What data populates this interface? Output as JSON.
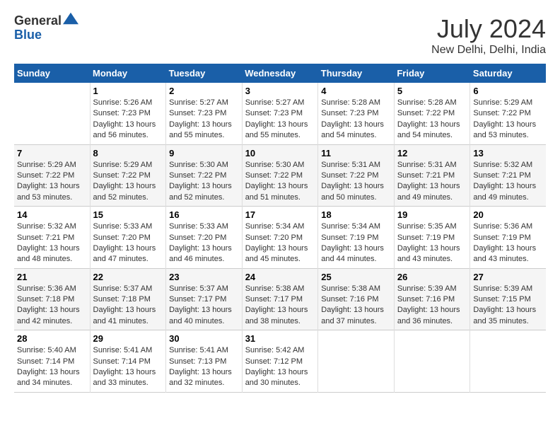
{
  "logo": {
    "general": "General",
    "blue": "Blue"
  },
  "title": "July 2024",
  "subtitle": "New Delhi, Delhi, India",
  "headers": [
    "Sunday",
    "Monday",
    "Tuesday",
    "Wednesday",
    "Thursday",
    "Friday",
    "Saturday"
  ],
  "weeks": [
    [
      {
        "day": "",
        "info": ""
      },
      {
        "day": "1",
        "info": "Sunrise: 5:26 AM\nSunset: 7:23 PM\nDaylight: 13 hours\nand 56 minutes."
      },
      {
        "day": "2",
        "info": "Sunrise: 5:27 AM\nSunset: 7:23 PM\nDaylight: 13 hours\nand 55 minutes."
      },
      {
        "day": "3",
        "info": "Sunrise: 5:27 AM\nSunset: 7:23 PM\nDaylight: 13 hours\nand 55 minutes."
      },
      {
        "day": "4",
        "info": "Sunrise: 5:28 AM\nSunset: 7:23 PM\nDaylight: 13 hours\nand 54 minutes."
      },
      {
        "day": "5",
        "info": "Sunrise: 5:28 AM\nSunset: 7:22 PM\nDaylight: 13 hours\nand 54 minutes."
      },
      {
        "day": "6",
        "info": "Sunrise: 5:29 AM\nSunset: 7:22 PM\nDaylight: 13 hours\nand 53 minutes."
      }
    ],
    [
      {
        "day": "7",
        "info": "Sunrise: 5:29 AM\nSunset: 7:22 PM\nDaylight: 13 hours\nand 53 minutes."
      },
      {
        "day": "8",
        "info": "Sunrise: 5:29 AM\nSunset: 7:22 PM\nDaylight: 13 hours\nand 52 minutes."
      },
      {
        "day": "9",
        "info": "Sunrise: 5:30 AM\nSunset: 7:22 PM\nDaylight: 13 hours\nand 52 minutes."
      },
      {
        "day": "10",
        "info": "Sunrise: 5:30 AM\nSunset: 7:22 PM\nDaylight: 13 hours\nand 51 minutes."
      },
      {
        "day": "11",
        "info": "Sunrise: 5:31 AM\nSunset: 7:22 PM\nDaylight: 13 hours\nand 50 minutes."
      },
      {
        "day": "12",
        "info": "Sunrise: 5:31 AM\nSunset: 7:21 PM\nDaylight: 13 hours\nand 49 minutes."
      },
      {
        "day": "13",
        "info": "Sunrise: 5:32 AM\nSunset: 7:21 PM\nDaylight: 13 hours\nand 49 minutes."
      }
    ],
    [
      {
        "day": "14",
        "info": "Sunrise: 5:32 AM\nSunset: 7:21 PM\nDaylight: 13 hours\nand 48 minutes."
      },
      {
        "day": "15",
        "info": "Sunrise: 5:33 AM\nSunset: 7:20 PM\nDaylight: 13 hours\nand 47 minutes."
      },
      {
        "day": "16",
        "info": "Sunrise: 5:33 AM\nSunset: 7:20 PM\nDaylight: 13 hours\nand 46 minutes."
      },
      {
        "day": "17",
        "info": "Sunrise: 5:34 AM\nSunset: 7:20 PM\nDaylight: 13 hours\nand 45 minutes."
      },
      {
        "day": "18",
        "info": "Sunrise: 5:34 AM\nSunset: 7:19 PM\nDaylight: 13 hours\nand 44 minutes."
      },
      {
        "day": "19",
        "info": "Sunrise: 5:35 AM\nSunset: 7:19 PM\nDaylight: 13 hours\nand 43 minutes."
      },
      {
        "day": "20",
        "info": "Sunrise: 5:36 AM\nSunset: 7:19 PM\nDaylight: 13 hours\nand 43 minutes."
      }
    ],
    [
      {
        "day": "21",
        "info": "Sunrise: 5:36 AM\nSunset: 7:18 PM\nDaylight: 13 hours\nand 42 minutes."
      },
      {
        "day": "22",
        "info": "Sunrise: 5:37 AM\nSunset: 7:18 PM\nDaylight: 13 hours\nand 41 minutes."
      },
      {
        "day": "23",
        "info": "Sunrise: 5:37 AM\nSunset: 7:17 PM\nDaylight: 13 hours\nand 40 minutes."
      },
      {
        "day": "24",
        "info": "Sunrise: 5:38 AM\nSunset: 7:17 PM\nDaylight: 13 hours\nand 38 minutes."
      },
      {
        "day": "25",
        "info": "Sunrise: 5:38 AM\nSunset: 7:16 PM\nDaylight: 13 hours\nand 37 minutes."
      },
      {
        "day": "26",
        "info": "Sunrise: 5:39 AM\nSunset: 7:16 PM\nDaylight: 13 hours\nand 36 minutes."
      },
      {
        "day": "27",
        "info": "Sunrise: 5:39 AM\nSunset: 7:15 PM\nDaylight: 13 hours\nand 35 minutes."
      }
    ],
    [
      {
        "day": "28",
        "info": "Sunrise: 5:40 AM\nSunset: 7:14 PM\nDaylight: 13 hours\nand 34 minutes."
      },
      {
        "day": "29",
        "info": "Sunrise: 5:41 AM\nSunset: 7:14 PM\nDaylight: 13 hours\nand 33 minutes."
      },
      {
        "day": "30",
        "info": "Sunrise: 5:41 AM\nSunset: 7:13 PM\nDaylight: 13 hours\nand 32 minutes."
      },
      {
        "day": "31",
        "info": "Sunrise: 5:42 AM\nSunset: 7:12 PM\nDaylight: 13 hours\nand 30 minutes."
      },
      {
        "day": "",
        "info": ""
      },
      {
        "day": "",
        "info": ""
      },
      {
        "day": "",
        "info": ""
      }
    ]
  ]
}
